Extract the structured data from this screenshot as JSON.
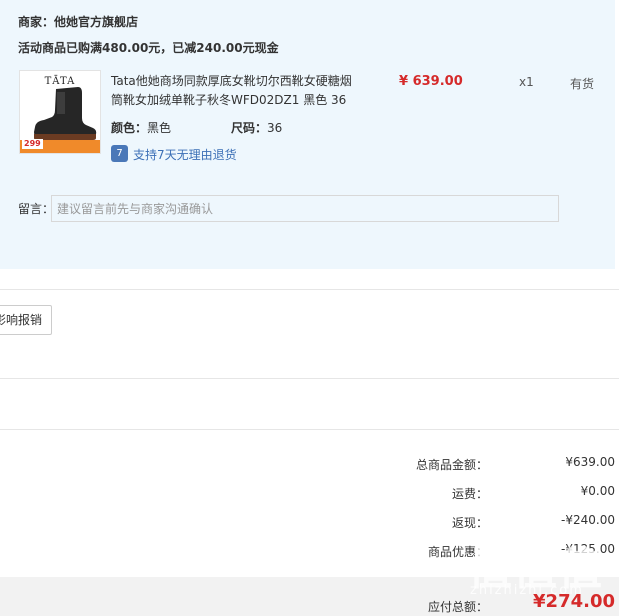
{
  "store": {
    "name": "商家：他她官方旗舰店",
    "promotion": "活动商品已购满480.00元，已减240.00元现金"
  },
  "product": {
    "thumbnail": {
      "brand_text": "TĀTA",
      "price_tag": "299"
    },
    "title": "Tata他她商场同款厚底女靴切尔西靴女硬糖烟筒靴女加绒单靴子秋冬WFD02DZ1 黑色 36",
    "price": "¥ 639.00",
    "quantity": "x1",
    "stock": "有货",
    "color_label": "颜色：",
    "color_value": "黑色",
    "size_label": "尺码：",
    "size_value": "36",
    "return_icon": "7",
    "return_policy": "支持7天无理由退货"
  },
  "message": {
    "label": "留言：",
    "placeholder": "建议留言前先与商家沟通确认"
  },
  "reimburse_button": "影响报销",
  "summary": [
    {
      "label": "总商品金额：",
      "value": "¥639.00"
    },
    {
      "label": "运费：",
      "value": "¥0.00"
    },
    {
      "label": "返现：",
      "value": "-¥240.00"
    },
    {
      "label": "商品优惠：",
      "value": "-¥125.00"
    }
  ],
  "payable": {
    "label": "应付总额：",
    "value": "¥274.00"
  },
  "watermark": {
    "main": "值值值",
    "sub": "zhizhizhi.com"
  }
}
